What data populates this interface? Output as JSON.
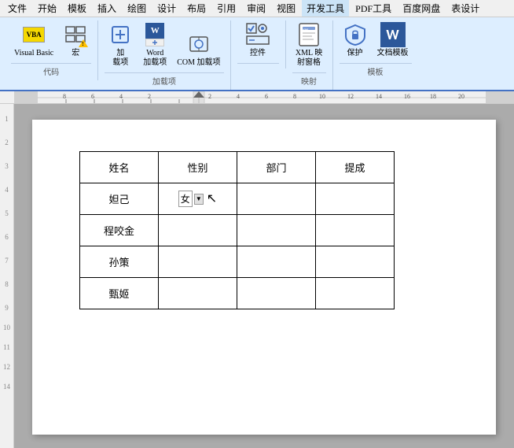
{
  "menu": {
    "items": [
      {
        "label": "文件",
        "active": false
      },
      {
        "label": "开始",
        "active": false
      },
      {
        "label": "模板",
        "active": false
      },
      {
        "label": "插入",
        "active": false
      },
      {
        "label": "绘图",
        "active": false
      },
      {
        "label": "设计",
        "active": false
      },
      {
        "label": "布局",
        "active": false
      },
      {
        "label": "引用",
        "active": false
      },
      {
        "label": "审阅",
        "active": false
      },
      {
        "label": "视图",
        "active": false
      },
      {
        "label": "开发工具",
        "active": true
      },
      {
        "label": "PDF工具",
        "active": false
      },
      {
        "label": "百度网盘",
        "active": false
      },
      {
        "label": "表设计",
        "active": false
      }
    ]
  },
  "ribbon": {
    "groups": [
      {
        "label": "代码",
        "items": [
          {
            "id": "vbasic",
            "label": "Visual Basic",
            "type": "large"
          },
          {
            "id": "macro",
            "label": "宏",
            "type": "large"
          }
        ]
      },
      {
        "label": "加载项",
        "items": [
          {
            "id": "add",
            "label": "加\n载项",
            "type": "large"
          },
          {
            "id": "word-add",
            "label": "Word\n加载项",
            "type": "large"
          },
          {
            "id": "com-add",
            "label": "COM 加载项",
            "type": "large"
          }
        ]
      },
      {
        "label": "",
        "items": [
          {
            "id": "control",
            "label": "控件",
            "type": "large"
          }
        ]
      },
      {
        "label": "映射",
        "items": [
          {
            "id": "xml-map",
            "label": "XML 映\n射窗格",
            "type": "large"
          }
        ]
      },
      {
        "label": "模板",
        "items": [
          {
            "id": "protect",
            "label": "保护",
            "type": "large"
          },
          {
            "id": "doc-template",
            "label": "文档模板",
            "type": "large"
          }
        ]
      }
    ]
  },
  "table": {
    "headers": [
      "姓名",
      "性别",
      "部门",
      "提成"
    ],
    "rows": [
      {
        "name": "妲己",
        "gender": "女",
        "dept": "",
        "commission": ""
      },
      {
        "name": "程咬金",
        "gender": "",
        "dept": "",
        "commission": ""
      },
      {
        "name": "孙策",
        "gender": "",
        "dept": "",
        "commission": ""
      },
      {
        "name": "甄姬",
        "gender": "",
        "dept": "",
        "commission": ""
      }
    ]
  }
}
